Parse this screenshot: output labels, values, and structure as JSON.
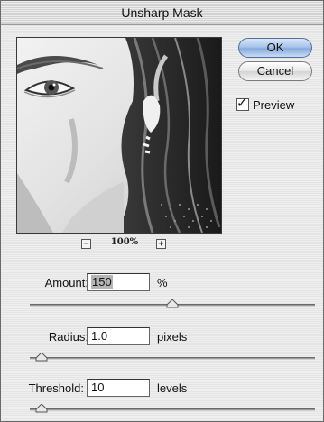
{
  "window": {
    "title": "Unsharp Mask"
  },
  "buttons": {
    "ok_label": "OK",
    "cancel_label": "Cancel"
  },
  "preview": {
    "checkbox_label": "Preview",
    "checked": true,
    "zoom_label": "100%",
    "zoom_out_symbol": "−",
    "zoom_in_symbol": "+"
  },
  "params": {
    "amount": {
      "label": "Amount:",
      "value": "150",
      "unit": "%",
      "slider_fraction": 0.5
    },
    "radius": {
      "label": "Radius:",
      "value": "1.0",
      "unit": "pixels",
      "slider_fraction": 0.04
    },
    "threshold": {
      "label": "Threshold:",
      "value": "10",
      "unit": "levels",
      "slider_fraction": 0.04
    }
  },
  "colors": {
    "ok_button": "#a9c4ea",
    "dialog_background": "#ececec"
  }
}
